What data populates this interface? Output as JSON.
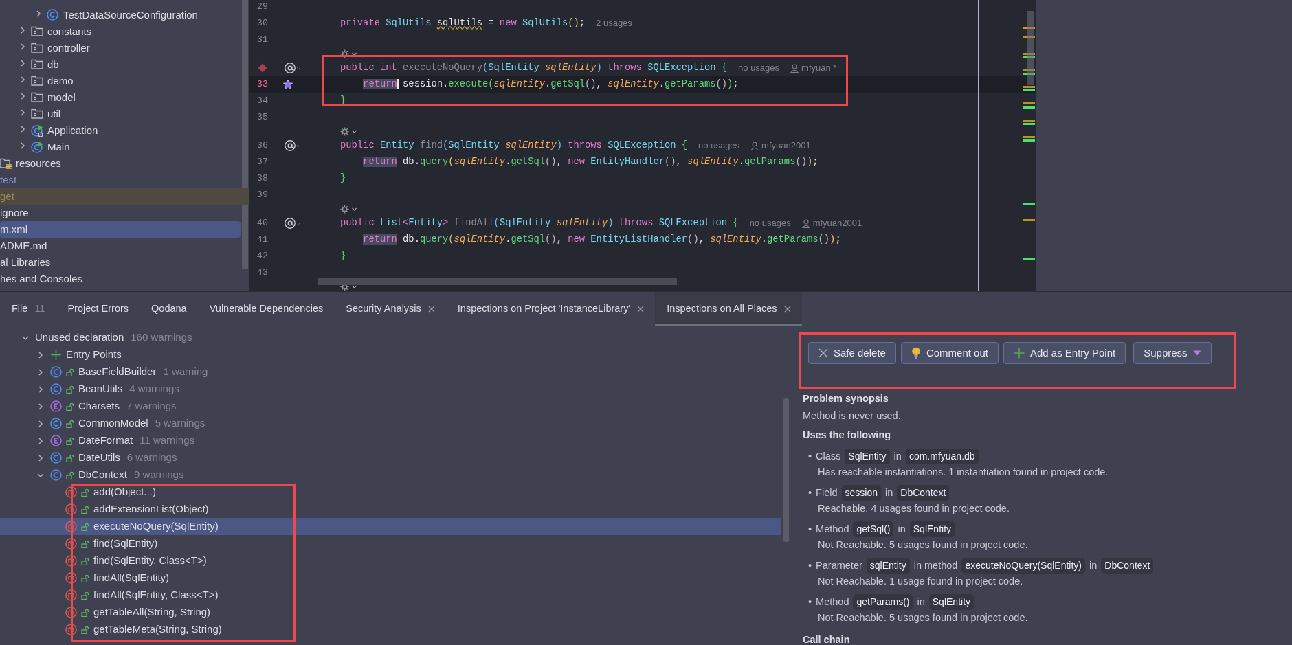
{
  "project_tree": {
    "items": [
      {
        "children": [
          {
            "children": [
              {
                "children": [
                  {
                    "children": [
                      {
                        "children": [
                          {
                            "label": "TestDataSourceConfiguration",
                            "kind": "class",
                            "expanded": false,
                            "selected": false
                          }
                        ]
                      },
                      {
                        "label": "constants",
                        "kind": "package",
                        "expanded": false,
                        "selected": false
                      },
                      {
                        "label": "controller",
                        "kind": "package",
                        "expanded": false,
                        "selected": false
                      },
                      {
                        "label": "db",
                        "kind": "package",
                        "expanded": false,
                        "selected": false
                      },
                      {
                        "label": "demo",
                        "kind": "package",
                        "expanded": false,
                        "selected": false
                      },
                      {
                        "label": "model",
                        "kind": "package",
                        "expanded": false,
                        "selected": false
                      },
                      {
                        "label": "util",
                        "kind": "package",
                        "expanded": false,
                        "selected": false
                      },
                      {
                        "label": "Application",
                        "kind": "boot-class",
                        "expanded": false,
                        "selected": false
                      },
                      {
                        "label": "Main",
                        "kind": "main-class",
                        "expanded": false,
                        "selected": false
                      }
                    ]
                  }
                ]
              },
              {
                "label": "resources",
                "kind": "resource-root",
                "selected": false
              }
            ]
          },
          {
            "label": "test",
            "color": "#7f90c8",
            "selected": false
          }
        ]
      },
      {
        "label": "get",
        "color": "#9c8a5c",
        "excluded": true,
        "selected": false
      },
      {
        "label": "ignore",
        "selected": false
      },
      {
        "label": "m.xml",
        "selected": true
      },
      {
        "label": "ADME.md",
        "selected": false
      },
      {
        "label": "al Libraries",
        "selected": false
      },
      {
        "label": "hes and Consoles",
        "selected": false
      }
    ]
  },
  "editor": {
    "lines": [
      {
        "kind": "code",
        "number": "29"
      },
      {
        "kind": "code",
        "number": "30",
        "tokens": [
          {
            "kind": "kw",
            "text": "private "
          },
          {
            "kind": "type",
            "text": "SqlUtils "
          },
          {
            "kind": "warn",
            "text": "sqlUtils"
          },
          {
            "kind": "plain",
            "text": " = "
          },
          {
            "kind": "kw",
            "text": "new "
          },
          {
            "kind": "type",
            "text": "SqlUtils"
          },
          {
            "kind": "brace-yellow",
            "text": "()"
          },
          {
            "kind": "plain",
            "text": ";"
          }
        ],
        "hints": [
          {
            "kind": "usages",
            "text": "2 usages"
          }
        ]
      },
      {
        "kind": "code",
        "number": "31"
      },
      {
        "kind": "lens"
      },
      {
        "kind": "code",
        "gutter_mark": {
          "kind": "breakpoint"
        },
        "annotated": true,
        "tokens": [
          {
            "kind": "kw",
            "text": "public "
          },
          {
            "kind": "kw",
            "text": "int "
          },
          {
            "kind": "unused",
            "text": "executeNoQuery"
          },
          {
            "kind": "brace-blue",
            "text": "("
          },
          {
            "kind": "type",
            "text": "SqlEntity "
          },
          {
            "kind": "param",
            "text": "sqlEntity"
          },
          {
            "kind": "brace-blue",
            "text": ")"
          },
          {
            "kind": "kw",
            "text": " throws "
          },
          {
            "kind": "type",
            "text": "SQLException "
          },
          {
            "kind": "brace-green",
            "text": "{"
          }
        ],
        "hints": [
          {
            "kind": "usages",
            "text": "no usages"
          },
          {
            "kind": "author",
            "text": "mfyuan *"
          }
        ]
      },
      {
        "kind": "code",
        "number": "33",
        "gutter_mark": {
          "kind": "plugin"
        },
        "current": true,
        "indented": true,
        "tokens": [
          {
            "kind": "kw",
            "text": "return",
            "highlighted": true,
            "cursor": true
          },
          {
            "kind": "plain",
            "text": " session."
          },
          {
            "kind": "method",
            "text": "execute"
          },
          {
            "kind": "brace-green",
            "text": "("
          },
          {
            "kind": "param",
            "text": "sqlEntity"
          },
          {
            "kind": "plain",
            "text": "."
          },
          {
            "kind": "method",
            "text": "getSql"
          },
          {
            "kind": "brace-grey",
            "text": "()"
          },
          {
            "kind": "plain",
            "text": ", "
          },
          {
            "kind": "param",
            "text": "sqlEntity"
          },
          {
            "kind": "plain",
            "text": "."
          },
          {
            "kind": "method",
            "text": "getParams"
          },
          {
            "kind": "brace-grey",
            "text": "()"
          },
          {
            "kind": "brace-green",
            "text": ")"
          },
          {
            "kind": "plain",
            "text": ";"
          }
        ]
      },
      {
        "kind": "code",
        "number": "34",
        "tokens": [
          {
            "kind": "brace-green",
            "text": "}"
          }
        ]
      },
      {
        "kind": "code",
        "number": "35"
      },
      {
        "kind": "lens"
      },
      {
        "kind": "code",
        "number": "36",
        "annotated": true,
        "tokens": [
          {
            "kind": "kw",
            "text": "public "
          },
          {
            "kind": "type",
            "text": "Entity "
          },
          {
            "kind": "unused",
            "text": "find"
          },
          {
            "kind": "brace-blue",
            "text": "("
          },
          {
            "kind": "type",
            "text": "SqlEntity "
          },
          {
            "kind": "param",
            "text": "sqlEntity"
          },
          {
            "kind": "brace-blue",
            "text": ")"
          },
          {
            "kind": "kw",
            "text": " throws "
          },
          {
            "kind": "type",
            "text": "SQLException "
          },
          {
            "kind": "brace-green",
            "text": "{"
          }
        ],
        "hints": [
          {
            "kind": "usages",
            "text": "no usages"
          },
          {
            "kind": "author",
            "text": "mfyuan2001"
          }
        ]
      },
      {
        "kind": "code",
        "number": "37",
        "indented": true,
        "tokens": [
          {
            "kind": "kw",
            "text": "return",
            "highlighted": true
          },
          {
            "kind": "plain",
            "text": " db."
          },
          {
            "kind": "method",
            "text": "query"
          },
          {
            "kind": "brace-yellow",
            "text": "("
          },
          {
            "kind": "param",
            "text": "sqlEntity"
          },
          {
            "kind": "plain",
            "text": "."
          },
          {
            "kind": "method",
            "text": "getSql"
          },
          {
            "kind": "brace-grey",
            "text": "()"
          },
          {
            "kind": "plain",
            "text": ", "
          },
          {
            "kind": "kw",
            "text": "new "
          },
          {
            "kind": "type",
            "text": "EntityHandler"
          },
          {
            "kind": "brace-grey",
            "text": "()"
          },
          {
            "kind": "plain",
            "text": ", "
          },
          {
            "kind": "param",
            "text": "sqlEntity"
          },
          {
            "kind": "plain",
            "text": "."
          },
          {
            "kind": "method",
            "text": "getParams"
          },
          {
            "kind": "brace-grey",
            "text": "()"
          },
          {
            "kind": "brace-yellow",
            "text": ")"
          },
          {
            "kind": "plain",
            "text": ";"
          }
        ]
      },
      {
        "kind": "code",
        "number": "38",
        "tokens": [
          {
            "kind": "brace-green",
            "text": "}"
          }
        ]
      },
      {
        "kind": "code",
        "number": "39"
      },
      {
        "kind": "lens"
      },
      {
        "kind": "code",
        "number": "40",
        "annotated": true,
        "tokens": [
          {
            "kind": "kw",
            "text": "public "
          },
          {
            "kind": "type",
            "text": "List"
          },
          {
            "kind": "kw",
            "text": "<"
          },
          {
            "kind": "type",
            "text": "Entity"
          },
          {
            "kind": "kw",
            "text": "> "
          },
          {
            "kind": "unused",
            "text": "findAll"
          },
          {
            "kind": "brace-blue",
            "text": "("
          },
          {
            "kind": "type",
            "text": "SqlEntity "
          },
          {
            "kind": "param",
            "text": "sqlEntity"
          },
          {
            "kind": "brace-blue",
            "text": ")"
          },
          {
            "kind": "kw",
            "text": " throws "
          },
          {
            "kind": "type",
            "text": "SQLException "
          },
          {
            "kind": "brace-green",
            "text": "{"
          }
        ],
        "hints": [
          {
            "kind": "usages",
            "text": "no usages"
          },
          {
            "kind": "author",
            "text": "mfyuan2001"
          }
        ]
      },
      {
        "kind": "code",
        "number": "41",
        "indented": true,
        "tokens": [
          {
            "kind": "kw",
            "text": "return",
            "highlighted": true
          },
          {
            "kind": "plain",
            "text": " db."
          },
          {
            "kind": "method",
            "text": "query"
          },
          {
            "kind": "brace-yellow",
            "text": "("
          },
          {
            "kind": "param",
            "text": "sqlEntity"
          },
          {
            "kind": "plain",
            "text": "."
          },
          {
            "kind": "method",
            "text": "getSql"
          },
          {
            "kind": "brace-grey",
            "text": "()"
          },
          {
            "kind": "plain",
            "text": ", "
          },
          {
            "kind": "kw",
            "text": "new "
          },
          {
            "kind": "type",
            "text": "EntityListHandler"
          },
          {
            "kind": "brace-grey",
            "text": "()"
          },
          {
            "kind": "plain",
            "text": ", "
          },
          {
            "kind": "param",
            "text": "sqlEntity"
          },
          {
            "kind": "plain",
            "text": "."
          },
          {
            "kind": "method",
            "text": "getParams"
          },
          {
            "kind": "brace-grey",
            "text": "()"
          },
          {
            "kind": "brace-yellow",
            "text": ")"
          },
          {
            "kind": "plain",
            "text": ";"
          }
        ]
      },
      {
        "kind": "code",
        "number": "42",
        "tokens": [
          {
            "kind": "brace-green",
            "text": "}"
          }
        ]
      },
      {
        "kind": "code",
        "number": "43"
      },
      {
        "kind": "lens"
      }
    ]
  },
  "tool_tabs": [
    {
      "label": "File",
      "count": "11",
      "closable": false,
      "selected": false
    },
    {
      "label": "Project Errors",
      "closable": false,
      "selected": false
    },
    {
      "label": "Qodana",
      "closable": false,
      "selected": false
    },
    {
      "label": "Vulnerable Dependencies",
      "closable": false,
      "selected": false
    },
    {
      "label": "Security Analysis",
      "closable": true,
      "selected": false
    },
    {
      "label": "Inspections on Project 'InstanceLibrary'",
      "closable": true,
      "selected": false
    },
    {
      "label": "Inspections on All Places",
      "closable": true,
      "selected": true
    }
  ],
  "problems_tree": {
    "items": [
      {
        "label": "Unused declaration",
        "count": "160 warnings",
        "expanded": true,
        "selected": false,
        "children": [
          {
            "label": "Entry Points",
            "kind": "entry-points",
            "expanded": false,
            "selected": false
          },
          {
            "label": "BaseFieldBuilder",
            "count": "1 warning",
            "kind": "class",
            "public": true,
            "expanded": false,
            "selected": false
          },
          {
            "label": "BeanUtils",
            "count": "4 warnings",
            "kind": "class",
            "public": true,
            "expanded": false,
            "selected": false
          },
          {
            "label": "Charsets",
            "count": "7 warnings",
            "kind": "enum",
            "public": true,
            "expanded": false,
            "selected": false
          },
          {
            "label": "CommonModel",
            "count": "5 warnings",
            "kind": "class",
            "public": true,
            "expanded": false,
            "selected": false
          },
          {
            "label": "DateFormat",
            "count": "11 warnings",
            "kind": "enum",
            "public": true,
            "expanded": false,
            "selected": false
          },
          {
            "label": "DateUtils",
            "count": "6 warnings",
            "kind": "class",
            "public": true,
            "expanded": false,
            "selected": false
          },
          {
            "label": "DbContext",
            "count": "9 warnings",
            "kind": "class",
            "public": true,
            "expanded": true,
            "selected": false,
            "children": [
              {
                "label": "add(Object...)",
                "kind": "method",
                "public": true,
                "selected": false
              },
              {
                "label": "addExtensionList(Object)",
                "kind": "method",
                "public": true,
                "selected": false
              },
              {
                "label": "executeNoQuery(SqlEntity)",
                "kind": "method",
                "public": true,
                "selected": true
              },
              {
                "label": "find(SqlEntity)",
                "kind": "method",
                "public": true,
                "selected": false
              },
              {
                "label": "find(SqlEntity, Class<T>)",
                "kind": "method",
                "public": true,
                "selected": false
              },
              {
                "label": "findAll(SqlEntity)",
                "kind": "method",
                "public": true,
                "selected": false
              },
              {
                "label": "findAll(SqlEntity, Class<T>)",
                "kind": "method",
                "public": true,
                "selected": false
              },
              {
                "label": "getTableAll(String, String)",
                "kind": "method",
                "public": true,
                "selected": false
              },
              {
                "label": "getTableMeta(String, String)",
                "kind": "method",
                "public": true,
                "selected": false
              }
            ]
          }
        ]
      }
    ]
  },
  "details": {
    "actions": [
      {
        "label": "Safe delete",
        "kind": "delete"
      },
      {
        "label": "Comment out",
        "kind": "comment"
      },
      {
        "label": "Add as Entry Point",
        "kind": "add"
      },
      {
        "label": "Suppress",
        "kind": "dropdown"
      }
    ],
    "synopsis_title": "Problem synopsis",
    "synopsis": "Method is never used.",
    "uses_title": "Uses the following",
    "uses": [
      {
        "bullet": "•",
        "parts": [
          {
            "kind": "text",
            "text": "Class"
          },
          {
            "kind": "code",
            "text": "SqlEntity"
          },
          {
            "kind": "text",
            "text": "in"
          },
          {
            "kind": "code",
            "text": "com.mfyuan.db"
          }
        ],
        "note": "Has reachable instantiations. 1 instantiation found in project code."
      },
      {
        "bullet": "•",
        "parts": [
          {
            "kind": "text",
            "text": "Field"
          },
          {
            "kind": "code",
            "text": "session"
          },
          {
            "kind": "text",
            "text": "in"
          },
          {
            "kind": "code",
            "text": "DbContext"
          }
        ],
        "note": "Reachable. 4 usages found in project code."
      },
      {
        "bullet": "•",
        "parts": [
          {
            "kind": "text",
            "text": "Method"
          },
          {
            "kind": "code",
            "text": "getSql()"
          },
          {
            "kind": "text",
            "text": "in"
          },
          {
            "kind": "code",
            "text": "SqlEntity"
          }
        ],
        "note": "Not Reachable. 5 usages found in project code."
      },
      {
        "bullet": "•",
        "parts": [
          {
            "kind": "text",
            "text": "Parameter"
          },
          {
            "kind": "code",
            "text": "sqlEntity"
          },
          {
            "kind": "text",
            "text": "in method"
          },
          {
            "kind": "code",
            "text": "executeNoQuery(SqlEntity)"
          },
          {
            "kind": "text",
            "text": "in"
          },
          {
            "kind": "code",
            "text": "DbContext"
          }
        ],
        "note": "Not Reachable. 1 usage found in project code."
      },
      {
        "bullet": "•",
        "parts": [
          {
            "kind": "text",
            "text": "Method"
          },
          {
            "kind": "code",
            "text": "getParams()"
          },
          {
            "kind": "text",
            "text": "in"
          },
          {
            "kind": "code",
            "text": "SqlEntity"
          }
        ],
        "note": "Not Reachable. 5 usages found in project code."
      }
    ],
    "call_chain_title": "Call chain"
  }
}
